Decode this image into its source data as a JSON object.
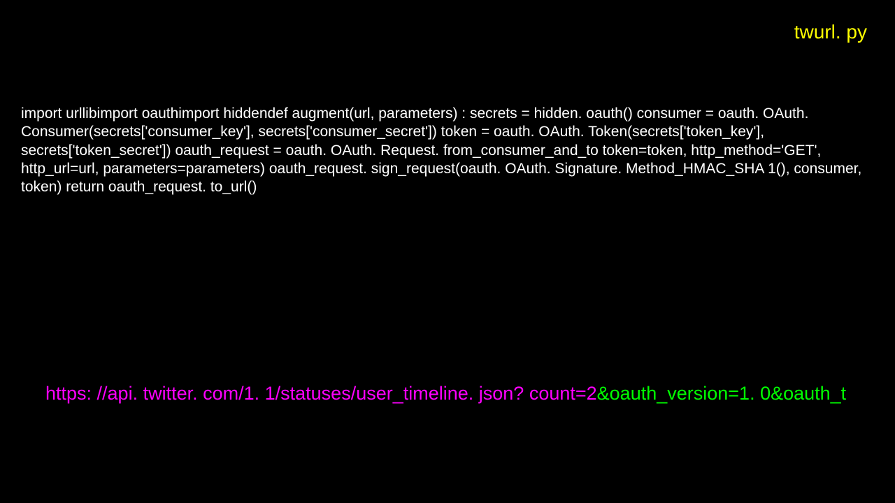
{
  "title": "twurl. py",
  "code": "import urllibimport oauthimport hiddendef augment(url, parameters) :    secrets = hidden. oauth()    consumer = oauth. OAuth. Consumer(secrets['consumer_key'], secrets['consumer_secret'])    token = oauth. OAuth. Token(secrets['token_key'], secrets['token_secret'])    oauth_request = oauth. OAuth. Request. from_consumer_and_to token=token, http_method='GET', http_url=url, parameters=parameters)    oauth_request. sign_request(oauth. OAuth. Signature. Method_HMAC_SHA 1(), consumer, token)    return oauth_request. to_url()",
  "url": {
    "base": "https: //api. twitter. com/1. 1/statuses/user_timeline. json? count=2",
    "oauth": "&oauth_version=1. 0&oauth_t"
  }
}
